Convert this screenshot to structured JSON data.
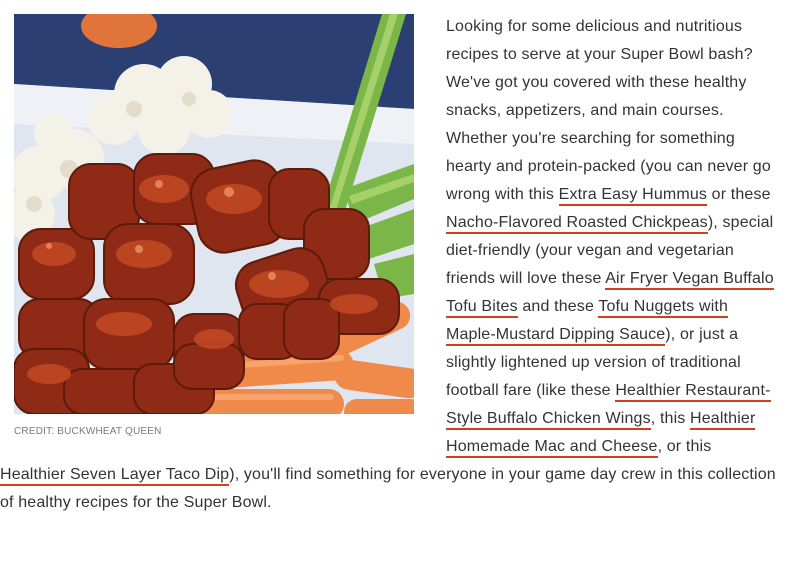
{
  "figure": {
    "alt": "Buffalo tofu bites with cauliflower, celery and carrots",
    "credit": "CREDIT: BUCKWHEAT QUEEN"
  },
  "paragraph": {
    "t1": "Looking for some delicious and nutritious recipes to serve at your Super Bowl bash? We've got you covered with these healthy snacks, appetizers, and main courses. Whether you're searching for something hearty and protein-packed (you can never go wrong with this ",
    "link1": "Extra Easy Hummus",
    "t2": " or these ",
    "link2": "Nacho-Flavored Roasted Chickpeas",
    "t3": "), special diet-friendly (your vegan and vegetarian friends will love these ",
    "link3": "Air Fryer Vegan Buffalo Tofu Bites",
    "t4": " and these ",
    "link4": "Tofu Nuggets with Maple-Mustard Dipping Sauce",
    "t5": "), or just a slightly lightened up version of traditional football fare (like these ",
    "link5": "Healthier Restaurant-Style Buffalo Chicken Wings",
    "t6": ", this ",
    "link6": "Healthier Homemade Mac and Cheese",
    "t7": ", or this ",
    "link7": "Healthier Seven Layer Taco Dip",
    "t8": "), you'll find something for everyone in your game day crew in this collection of healthy recipes for the Super Bowl."
  },
  "colors": {
    "link_underline": "#d0401c",
    "text": "#333333",
    "credit": "#7a7a7a"
  }
}
